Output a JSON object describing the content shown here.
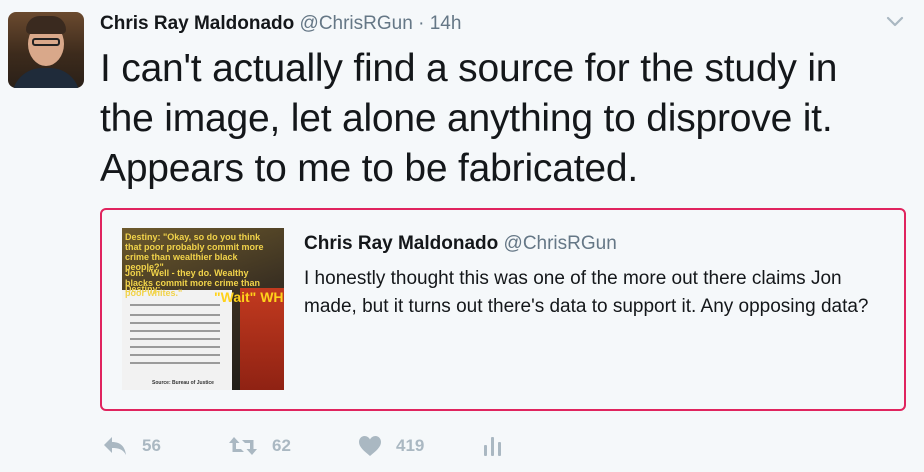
{
  "tweet": {
    "author_name": "Chris Ray Maldonado",
    "author_handle": "@ChrisRGun",
    "separator": "·",
    "timestamp": "14h",
    "text": "I can't actually find a source for the study in the image, let alone anything to disprove it. Appears to me to be fabricated."
  },
  "quote": {
    "author_name": "Chris Ray Maldonado",
    "author_handle": "@ChrisRGun",
    "text": "I honestly thought this was one of the more out there claims Jon made, but it turns out there's data to support it. Any opposing data?",
    "thumbnail": {
      "caption_1": "Destiny: \"Okay, so do you think that poor probably commit more crime than wealthier black people?\"",
      "caption_2": "Jon: \"Well - they do. Wealthy blacks commit more crime than poor whites.\"",
      "caption_3": "Destiny:",
      "caption_4": "\"Wait\" WHA",
      "caption_5": "Source: Bureau of Justice"
    }
  },
  "actions": {
    "reply_count": "56",
    "retweet_count": "62",
    "like_count": "419"
  },
  "icons": {
    "reply": "reply-icon",
    "retweet": "retweet-icon",
    "like": "heart-icon",
    "analytics": "analytics-icon",
    "more": "chevron-down-icon"
  },
  "colors": {
    "text": "#14171a",
    "secondary": "#657786",
    "action_gray": "#aab8c2",
    "quote_border": "#e0245e",
    "background": "#f5f8fa"
  }
}
